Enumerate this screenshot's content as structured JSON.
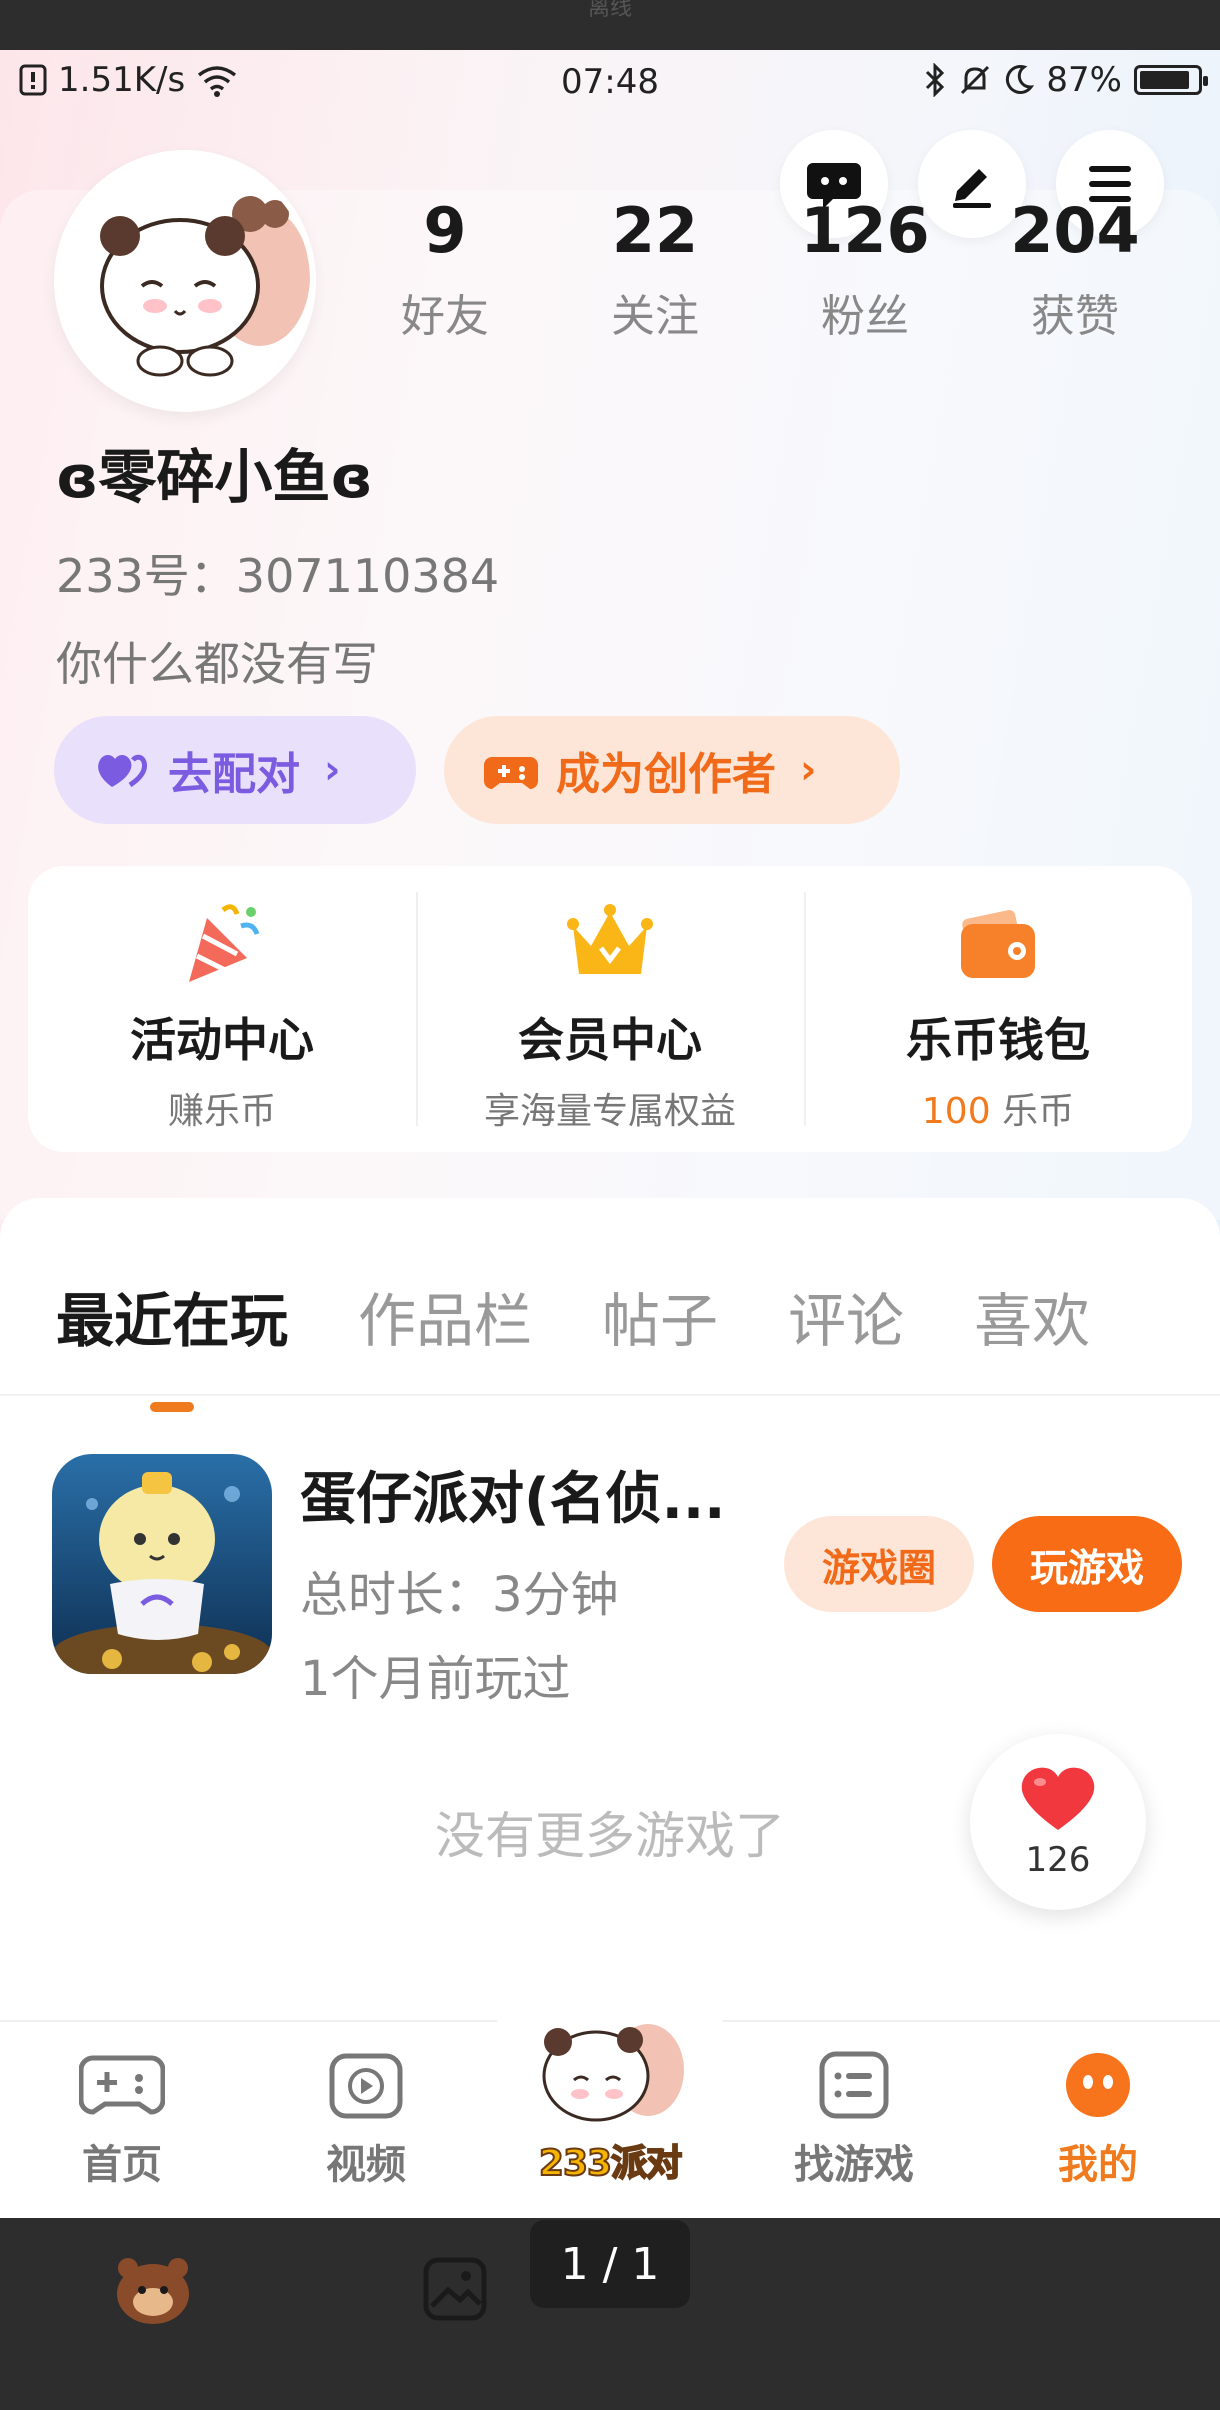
{
  "viewer": {
    "top_text": "离线",
    "page_indicator": "1 / 1"
  },
  "status": {
    "speed": "1.51K/s",
    "time": "07:48",
    "battery": "87%",
    "battery_level": 0.87
  },
  "profile": {
    "stats": [
      {
        "value": "9",
        "label": "好友"
      },
      {
        "value": "22",
        "label": "关注"
      },
      {
        "value": "126",
        "label": "粉丝"
      },
      {
        "value": "204",
        "label": "获赞"
      }
    ],
    "nickname": "ɞ零碎小鱼ɞ",
    "uid": "233号：307110384",
    "bio": "你什么都没有写",
    "match_label": "去配对",
    "creator_label": "成为创作者"
  },
  "services": [
    {
      "title": "活动中心",
      "sub": "赚乐币"
    },
    {
      "title": "会员中心",
      "sub": "享海量专属权益"
    },
    {
      "title": "乐币钱包",
      "sub_value": "100",
      "sub_unit": " 乐币"
    }
  ],
  "tabs": [
    "最近在玩",
    "作品栏",
    "帖子",
    "评论",
    "喜欢"
  ],
  "game": {
    "title": "蛋仔派对(名侦...",
    "duration": "总时长：3分钟",
    "last_played": "1个月前玩过",
    "circle_label": "游戏圈",
    "play_label": "玩游戏"
  },
  "no_more": "没有更多游戏了",
  "likes": "126",
  "nav": {
    "home": "首页",
    "video": "视频",
    "party": "233派对",
    "find": "找游戏",
    "mine": "我的"
  },
  "colors": {
    "accent": "#f07a1e",
    "purple": "#7b5bdf"
  }
}
